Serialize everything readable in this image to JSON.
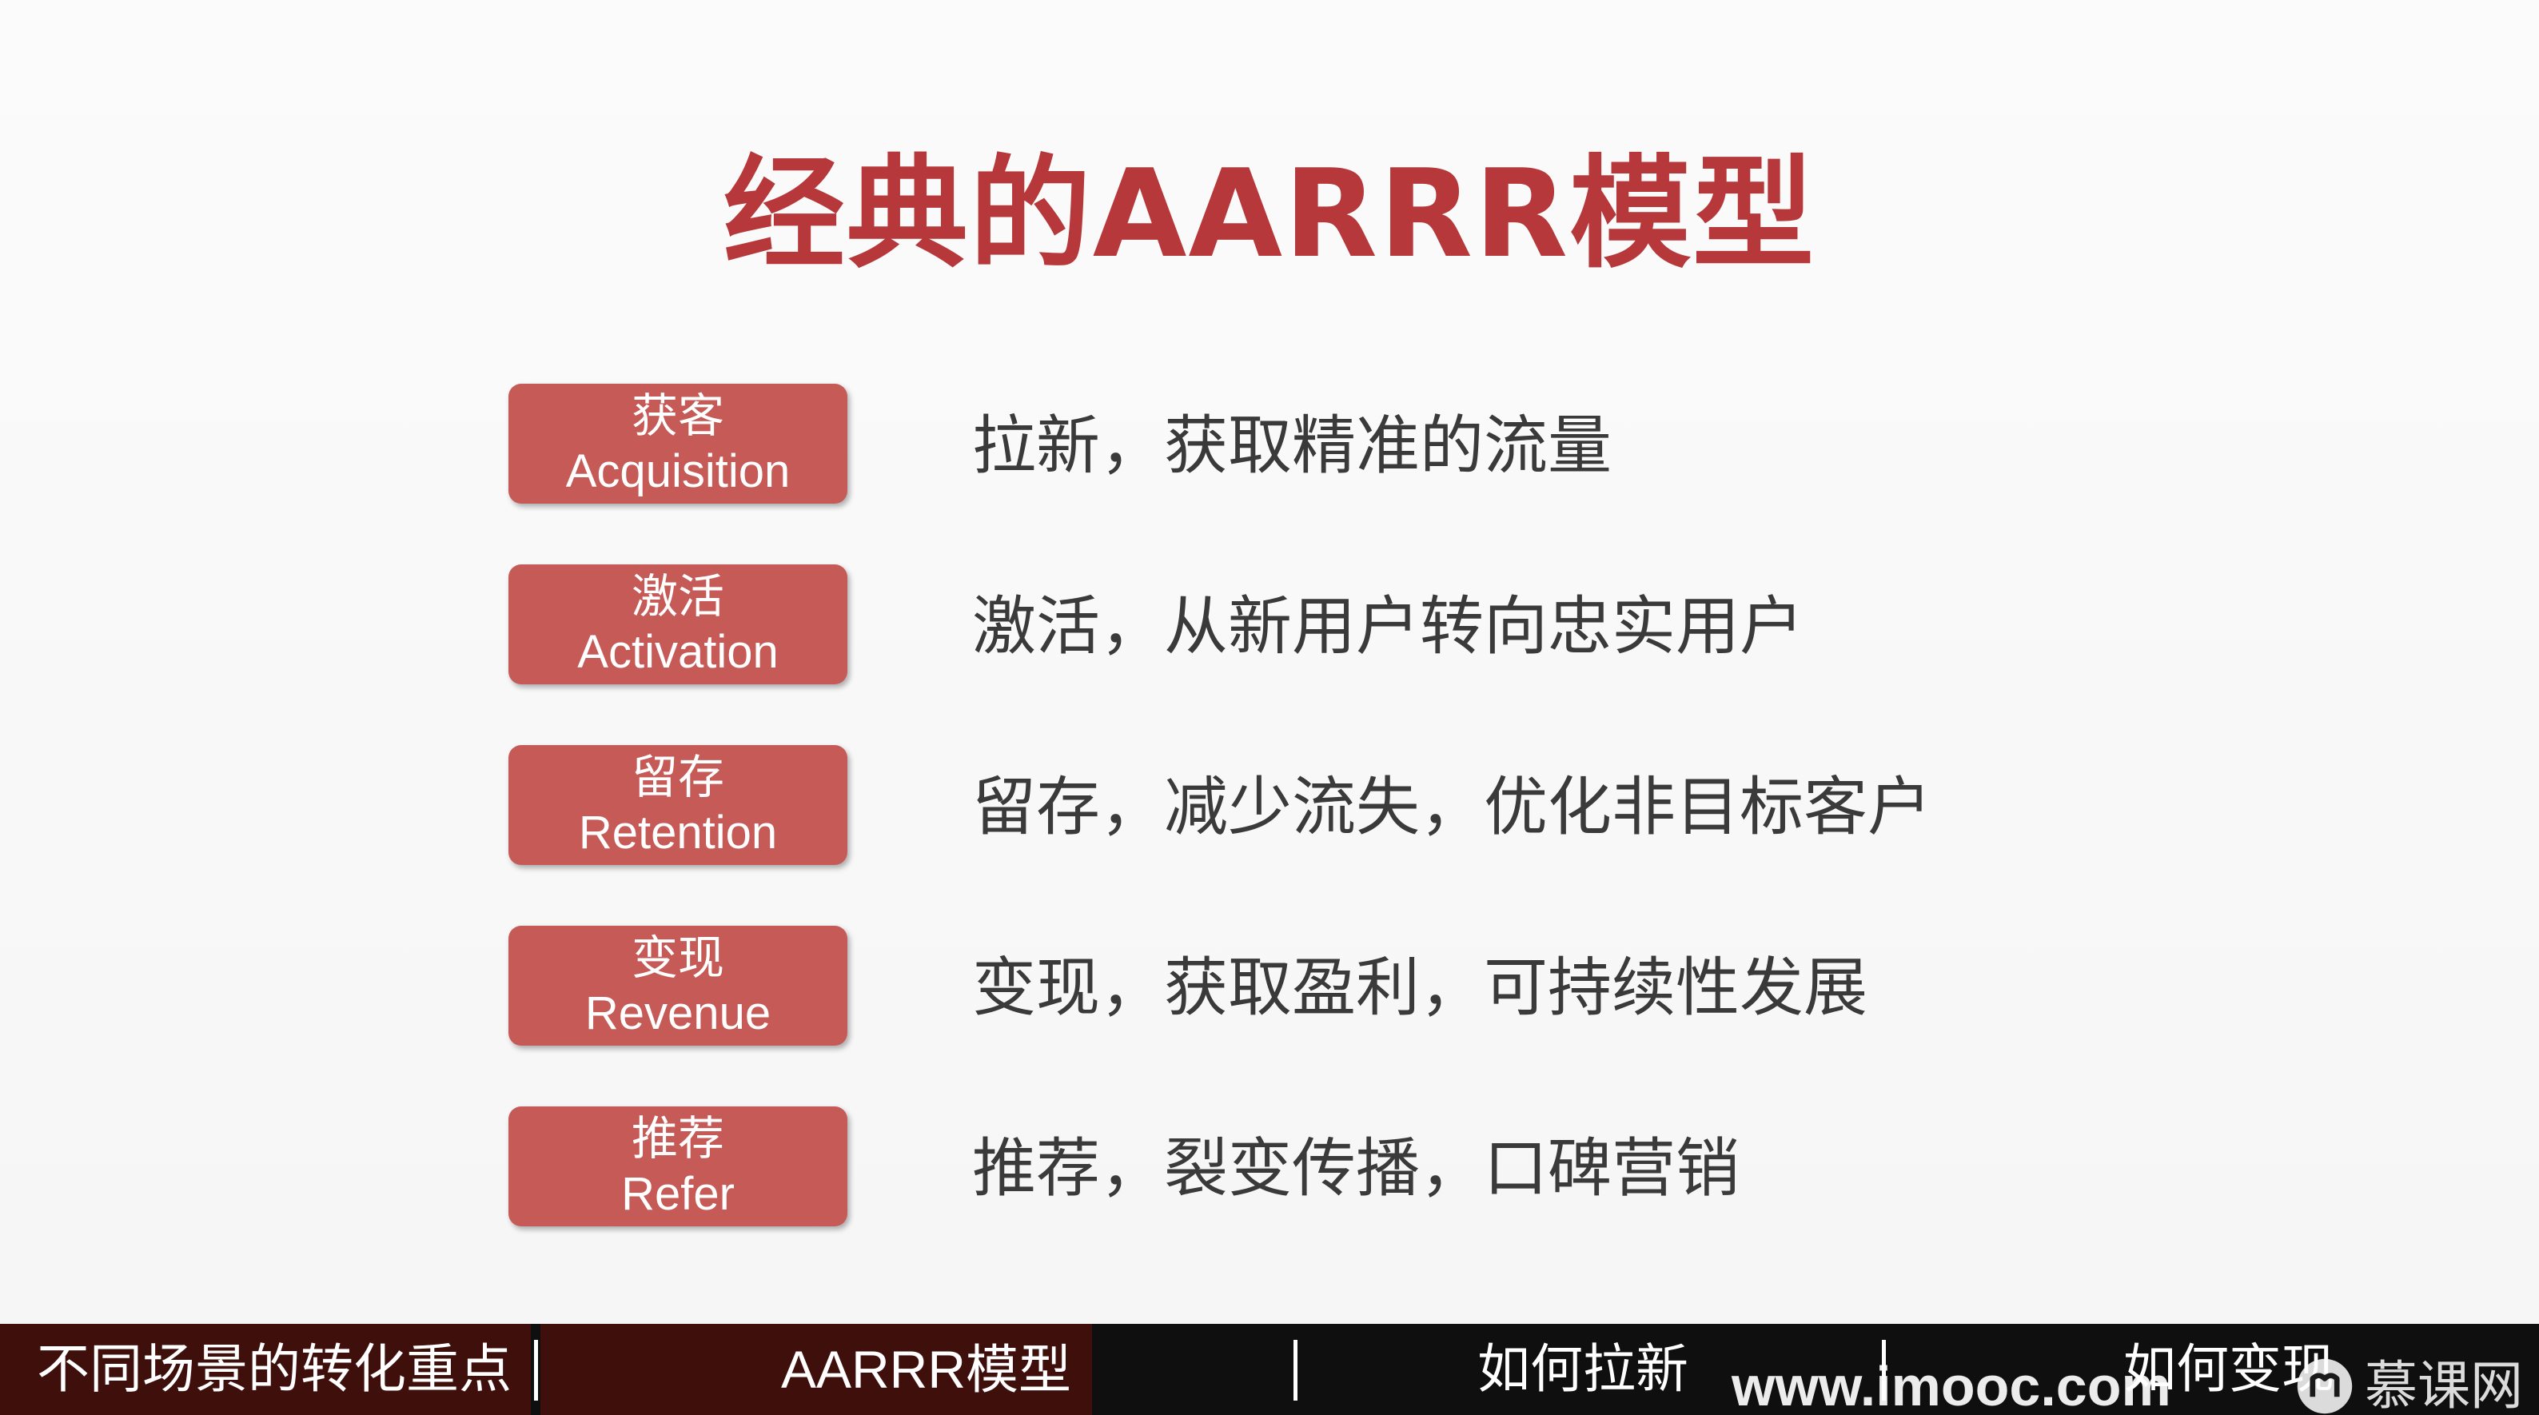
{
  "slide": {
    "title": "经典的AARRR模型",
    "stages": [
      {
        "cn": "获客",
        "en": "Acquisition",
        "desc": "拉新，获取精准的流量"
      },
      {
        "cn": "激活",
        "en": "Activation",
        "desc": "激活，从新用户转向忠实用户"
      },
      {
        "cn": "留存",
        "en": "Retention",
        "desc": "留存，减少流失，优化非目标客户"
      },
      {
        "cn": "变现",
        "en": "Revenue",
        "desc": "变现，获取盈利，可持续性发展"
      },
      {
        "cn": "推荐",
        "en": "Refer",
        "desc": "推荐，裂变传播，口碑营销"
      }
    ]
  },
  "chapter_bar": {
    "chapters": [
      {
        "label": "不同场景的转化重点"
      },
      {
        "label": "AARRR模型"
      },
      {
        "label": "如何拉新"
      },
      {
        "label": "如何变现"
      }
    ]
  },
  "watermark": {
    "url": "www.imooc.com",
    "brand": "慕课网",
    "icon": "imooc-logo-icon"
  },
  "colors": {
    "title": "#b7383a",
    "stage_box": "#c55a56",
    "description": "#3a3a3a",
    "chapter_bar": "#0f0f0f",
    "chapter_watched": "#3e0f0b"
  }
}
